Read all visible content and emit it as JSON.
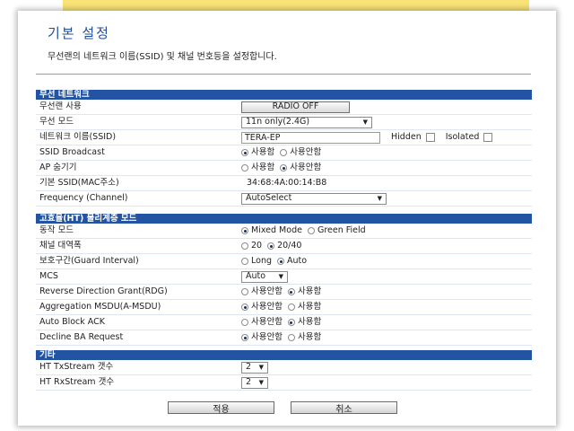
{
  "page": {
    "title": "기본 설정",
    "description": "무선랜의 네트워크 이름(SSID) 및 채널 번호등을 설정합니다."
  },
  "wireless": {
    "header": "무선 네트워크",
    "radio_label": "무선랜 사용",
    "radio_button": "RADIO OFF",
    "mode_label": "무선 모드",
    "mode_value": "11n only(2.4G)",
    "ssid_label": "네트워크 이름(SSID)",
    "ssid_value": "TERA-EP",
    "hidden_label": "Hidden",
    "isolated_label": "Isolated",
    "broadcast_label": "SSID Broadcast",
    "broadcast_opt_on": "사용함",
    "broadcast_opt_off": "사용안함",
    "ap_hide_label": "AP 숨기기",
    "ap_hide_opt_on": "사용함",
    "ap_hide_opt_off": "사용안함",
    "bssid_label": "기본 SSID(MAC주소)",
    "bssid_value": "34:68:4A:00:14:B8",
    "channel_label": "Frequency (Channel)",
    "channel_value": "AutoSelect"
  },
  "ht": {
    "header": "고효율(HT) 물리계층 모드",
    "op_mode_label": "동작 모드",
    "op_mode_opt1": "Mixed Mode",
    "op_mode_opt2": "Green Field",
    "bw_label": "채널 대역폭",
    "bw_opt1": "20",
    "bw_opt2": "20/40",
    "gi_label": "보호구간(Guard Interval)",
    "gi_opt1": "Long",
    "gi_opt2": "Auto",
    "mcs_label": "MCS",
    "mcs_value": "Auto",
    "rdg_label": "Reverse Direction Grant(RDG)",
    "rdg_opt1": "사용안함",
    "rdg_opt2": "사용함",
    "amsdu_label": "Aggregation MSDU(A-MSDU)",
    "amsdu_opt1": "사용안함",
    "amsdu_opt2": "사용함",
    "aba_label": "Auto Block ACK",
    "aba_opt1": "사용안함",
    "aba_opt2": "사용함",
    "dba_label": "Decline BA Request",
    "dba_opt1": "사용안함",
    "dba_opt2": "사용함"
  },
  "etc": {
    "header": "기타",
    "tx_label": "HT TxStream 갯수",
    "tx_value": "2",
    "rx_label": "HT RxStream 갯수",
    "rx_value": "2"
  },
  "footer": {
    "apply": "적용",
    "cancel": "취소"
  }
}
